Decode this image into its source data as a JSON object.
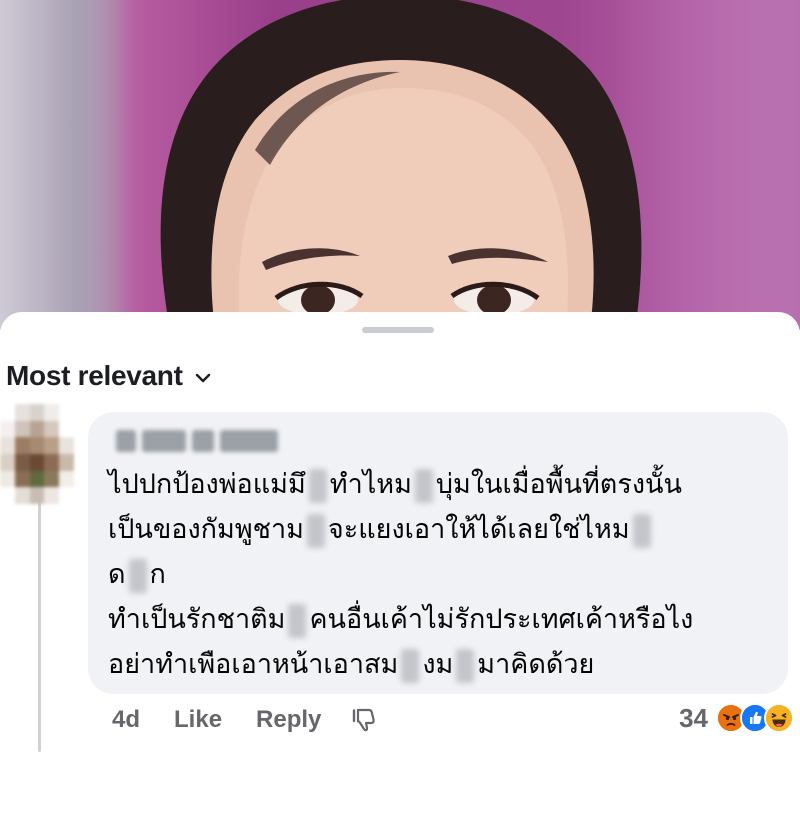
{
  "sheet": {
    "sort_label": "Most relevant"
  },
  "comment": {
    "lines": [
      "ไปปกป้องพ่อแม่มึ",
      "ทำไหม",
      "บุ่มในเมื่อพื้นที่ตรงนั้น",
      "เป็นของกัมพูชาม",
      "จะแยงเอาให้ได้เลยใช่ไหม",
      "ด",
      "ก",
      "ทำเป็นรักชาติม",
      "คนอื่นเค้าไม่รักประเทศเค้าหรือไง",
      "อย่าทำเพือเอาหน้าเอาสม",
      "งม",
      "มาคิดด้วย"
    ],
    "timestamp": "4d",
    "like_label": "Like",
    "reply_label": "Reply",
    "reaction_count": "34",
    "reaction_icons": [
      "angry-reaction-icon",
      "like-reaction-icon",
      "haha-reaction-icon"
    ]
  },
  "colors": {
    "sheet_bg": "#ffffff",
    "bubble_bg": "#f0f2f5",
    "text": "#050505",
    "muted": "#65676b",
    "like_blue": "#1877f2",
    "angry_orange": "#e9710f",
    "haha_yellow": "#f7b125"
  }
}
